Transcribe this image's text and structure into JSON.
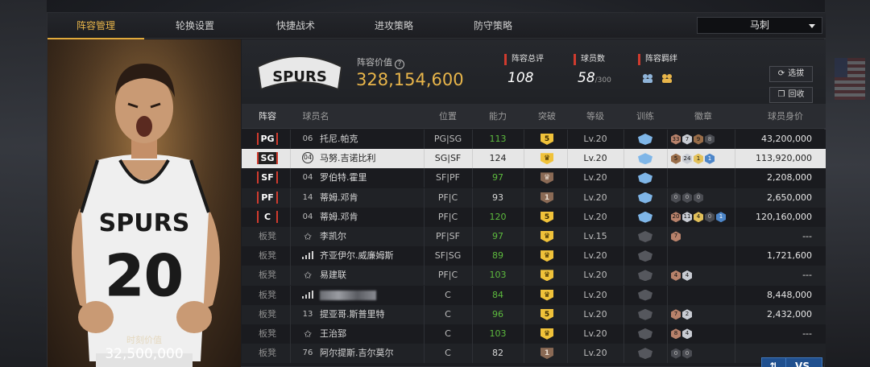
{
  "tabs": [
    "阵容管理",
    "轮换设置",
    "快捷战术",
    "进攻策略",
    "防守策略"
  ],
  "team_select": "马刺",
  "card": {
    "value_label": "时刻价值",
    "value": "32,500,000",
    "jersey_team": "SPURS",
    "jersey_number": "20"
  },
  "info": {
    "logo_text": "SPURS",
    "lineup_value_label": "阵容价值",
    "lineup_value": "328,154,600",
    "rating_label": "阵容总评",
    "rating": "108",
    "players_label": "球员数",
    "players": "58",
    "players_max": "/300",
    "bonds_label": "阵容羁绊",
    "select_btn": "选拔",
    "recycle_btn": "回收"
  },
  "columns": [
    "阵容",
    "球员名",
    "位置",
    "能力",
    "突破",
    "等级",
    "训练",
    "徽章",
    "球员身价"
  ],
  "rows": [
    {
      "slot": "PG",
      "starter": true,
      "num": "06",
      "icon": "number",
      "name": "托尼.帕克",
      "pos": "PG|SG",
      "ability": "113",
      "ability_green": true,
      "breakthrough": "5",
      "brk_color": "gold",
      "level": "Lv.20",
      "train": "blue",
      "badges": [
        [
          "33",
          "bronze"
        ],
        [
          "7",
          "silver"
        ],
        [
          "9",
          "brown"
        ],
        [
          "8",
          "dark"
        ]
      ],
      "value": "43,200,000"
    },
    {
      "slot": "SG",
      "starter": true,
      "num": "04",
      "icon": "number",
      "name": "马努.吉诺比利",
      "pos": "SG|SF",
      "ability": "124",
      "ability_green": false,
      "breakthrough": "♛",
      "brk_color": "gold",
      "level": "Lv.20",
      "train": "blue",
      "badges": [
        [
          "5",
          "brown"
        ],
        [
          "24",
          "silver"
        ],
        [
          "1",
          "gold"
        ],
        [
          "1",
          "blue"
        ]
      ],
      "value": "113,920,000",
      "selected": true
    },
    {
      "slot": "SF",
      "starter": true,
      "num": "04",
      "icon": "number",
      "name": "罗伯特.霍里",
      "pos": "SF|PF",
      "ability": "97",
      "ability_green": true,
      "breakthrough": "♛",
      "brk_color": "brown",
      "level": "Lv.20",
      "train": "blue",
      "badges": [],
      "value": "2,208,000"
    },
    {
      "slot": "PF",
      "starter": true,
      "num": "14",
      "icon": "number",
      "name": "蒂姆.邓肯",
      "pos": "PF|C",
      "ability": "93",
      "ability_green": false,
      "breakthrough": "1",
      "brk_color": "brown",
      "level": "Lv.20",
      "train": "blue",
      "badges": [
        [
          "0",
          "dark"
        ],
        [
          "0",
          "dark"
        ],
        [
          "0",
          "dark"
        ]
      ],
      "value": "2,650,000"
    },
    {
      "slot": "C",
      "starter": true,
      "num": "04",
      "icon": "number",
      "name": "蒂姆.邓肯",
      "pos": "PF|C",
      "ability": "120",
      "ability_green": true,
      "breakthrough": "5",
      "brk_color": "gold",
      "level": "Lv.20",
      "train": "blue",
      "badges": [
        [
          "20",
          "bronze"
        ],
        [
          "11",
          "silver"
        ],
        [
          "4",
          "gold"
        ],
        [
          "0",
          "dark"
        ],
        [
          "1",
          "blue"
        ]
      ],
      "value": "120,160,000"
    },
    {
      "slot": "板凳",
      "starter": false,
      "num": "",
      "icon": "star",
      "name": "李凯尔",
      "pos": "PF|SF",
      "ability": "97",
      "ability_green": true,
      "breakthrough": "♛",
      "brk_color": "gold",
      "level": "Lv.15",
      "train": "gray",
      "badges": [
        [
          "7",
          "bronze"
        ]
      ],
      "value": "---"
    },
    {
      "slot": "板凳",
      "starter": false,
      "num": "",
      "icon": "bars",
      "name": "齐亚伊尔.威廉姆斯",
      "pos": "SF|SG",
      "ability": "89",
      "ability_green": true,
      "breakthrough": "♛",
      "brk_color": "gold",
      "level": "Lv.20",
      "train": "gray",
      "badges": [],
      "value": "1,721,600"
    },
    {
      "slot": "板凳",
      "starter": false,
      "num": "",
      "icon": "star",
      "name": "易建联",
      "pos": "PF|C",
      "ability": "103",
      "ability_green": true,
      "breakthrough": "♛",
      "brk_color": "gold",
      "level": "Lv.20",
      "train": "gray",
      "badges": [
        [
          "4",
          "bronze"
        ],
        [
          "4",
          "silver"
        ]
      ],
      "value": "---"
    },
    {
      "slot": "板凳",
      "starter": false,
      "num": "",
      "icon": "bars",
      "name": "",
      "blurred": true,
      "pos": "C",
      "ability": "84",
      "ability_green": true,
      "breakthrough": "♛",
      "brk_color": "gold",
      "level": "Lv.20",
      "train": "gray",
      "badges": [],
      "value": "8,448,000"
    },
    {
      "slot": "板凳",
      "starter": false,
      "num": "13",
      "icon": "number",
      "name": "提亚哥.斯普里特",
      "pos": "C",
      "ability": "96",
      "ability_green": true,
      "breakthrough": "5",
      "brk_color": "gold",
      "level": "Lv.20",
      "train": "gray",
      "badges": [
        [
          "7",
          "bronze"
        ],
        [
          "2",
          "silver"
        ]
      ],
      "value": "2,432,000"
    },
    {
      "slot": "板凳",
      "starter": false,
      "num": "",
      "icon": "star",
      "name": "王治郅",
      "pos": "C",
      "ability": "103",
      "ability_green": true,
      "breakthrough": "♛",
      "brk_color": "gold",
      "level": "Lv.20",
      "train": "gray",
      "badges": [
        [
          "8",
          "bronze"
        ],
        [
          "4",
          "silver"
        ]
      ],
      "value": "---"
    },
    {
      "slot": "板凳",
      "starter": false,
      "num": "76",
      "icon": "number",
      "name": "阿尔提斯.吉尔莫尔",
      "pos": "C",
      "ability": "82",
      "ability_green": false,
      "breakthrough": "1",
      "brk_color": "brown",
      "level": "Lv.20",
      "train": "gray",
      "badges": [
        [
          "0",
          "dark"
        ],
        [
          "0",
          "dark"
        ]
      ],
      "value": ""
    }
  ],
  "vs_button": "VS",
  "colors": {
    "accent": "#e8b54a",
    "starter_mark": "#d03b2e",
    "green": "#5dbb3e",
    "vs": "#20508f"
  }
}
